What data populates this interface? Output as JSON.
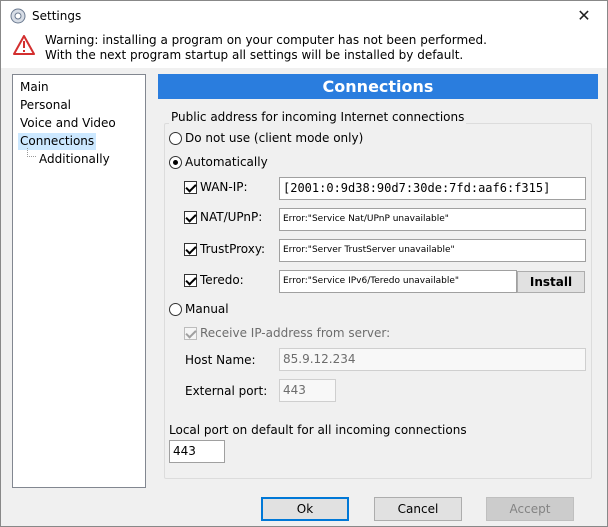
{
  "window": {
    "title": "Settings",
    "close_glyph": "✕"
  },
  "warning": {
    "line1": "Warning: installing a program on your computer has not been performed.",
    "line2": "With the next program startup all settings will be installed by default."
  },
  "tree": {
    "items": [
      {
        "label": "Main"
      },
      {
        "label": "Personal"
      },
      {
        "label": "Voice and Video"
      },
      {
        "label": "Connections",
        "selected": true
      },
      {
        "label": "Additionally"
      }
    ]
  },
  "panel": {
    "title": "Connections",
    "public_group_caption": "Public address for incoming Internet connections",
    "opt_no_use": "Do not use (client mode only)",
    "opt_auto": "Automatically",
    "wan_ip": {
      "label": "WAN-IP:",
      "value": "[2001:0:9d38:90d7:30de:7fd:aaf6:f315]"
    },
    "nat_upnp": {
      "label": "NAT/UPnP:",
      "value": "Error:\"Service Nat/UPnP unavailable\""
    },
    "trustproxy": {
      "label": "TrustProxy:",
      "value": "Error:\"Server TrustServer unavailable\""
    },
    "teredo": {
      "label": "Teredo:",
      "value": "Error:\"Service IPv6/Teredo unavailable\"",
      "install_label": "Install"
    },
    "opt_manual": "Manual",
    "receive_ip": "Receive IP-address from server:",
    "host_name": {
      "label": "Host Name:",
      "value": "85.9.12.234"
    },
    "external_port": {
      "label": "External port:",
      "value": "443"
    },
    "local_port": {
      "label": "Local port on default for all incoming connections",
      "value": "443"
    }
  },
  "buttons": {
    "ok": "Ok",
    "cancel": "Cancel",
    "accept": "Accept"
  },
  "colors": {
    "banner": "#2a7dde",
    "selection": "#cce8ff",
    "warning_red": "#d32f2f"
  }
}
